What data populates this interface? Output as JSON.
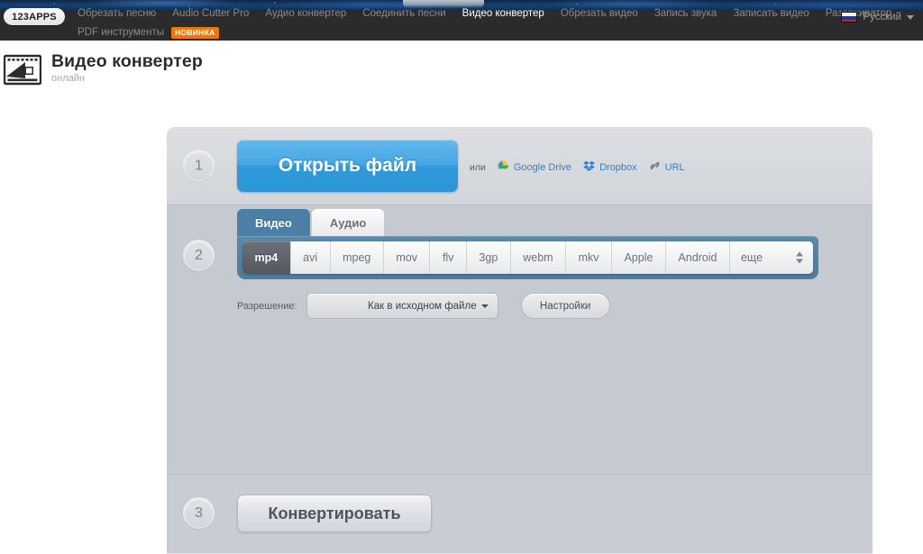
{
  "topnav": {
    "brand": "123APPS",
    "links_row1": [
      {
        "label": "Обрезать песню",
        "active": false
      },
      {
        "label": "Audio Cutter Pro",
        "active": false
      },
      {
        "label": "Аудио конвертер",
        "active": false
      },
      {
        "label": "Соединить песни",
        "active": false
      },
      {
        "label": "Видео конвертер",
        "active": true
      },
      {
        "label": "Обрезать видео",
        "active": false
      },
      {
        "label": "Запись звука",
        "active": false
      },
      {
        "label": "Записать видео",
        "active": false
      },
      {
        "label": "Разархиватор",
        "active": false
      }
    ],
    "links_row2": [
      {
        "label": "PDF инструменты",
        "active": false
      }
    ],
    "badge": "НОВИНКА",
    "badge_color": "#f0740f",
    "language": {
      "label": "Русский",
      "flag": "ru-flag-icon"
    }
  },
  "header": {
    "title": "Видео конвертер",
    "subtitle": "онлайн",
    "logo_icon": "video-converter-logo-icon"
  },
  "steps": {
    "one": {
      "number": "1",
      "open_button": "Открыть файл",
      "or_label": "или",
      "sources": [
        {
          "label": "Google Drive",
          "icon": "google-drive-icon"
        },
        {
          "label": "Dropbox",
          "icon": "dropbox-icon"
        },
        {
          "label": "URL",
          "icon": "link-icon"
        }
      ]
    },
    "two": {
      "number": "2",
      "tabs": [
        {
          "label": "Видео",
          "active": true
        },
        {
          "label": "Аудио",
          "active": false
        }
      ],
      "formats": [
        {
          "label": "mp4",
          "selected": true
        },
        {
          "label": "avi",
          "selected": false
        },
        {
          "label": "mpeg",
          "selected": false
        },
        {
          "label": "mov",
          "selected": false
        },
        {
          "label": "flv",
          "selected": false
        },
        {
          "label": "3gp",
          "selected": false
        },
        {
          "label": "webm",
          "selected": false
        },
        {
          "label": "mkv",
          "selected": false
        },
        {
          "label": "Apple",
          "selected": false
        },
        {
          "label": "Android",
          "selected": false
        }
      ],
      "more_label": "еще",
      "resolution_label": "Разрешение:",
      "resolution_value": "Как в исходном файле",
      "settings_button": "Настройки"
    },
    "three": {
      "number": "3",
      "convert_button": "Конвертировать"
    }
  },
  "colors": {
    "accent_blue": "#2f9ad9",
    "tab_blue": "#4b7fa6",
    "panel_gray": "#c8ccd3",
    "nav_dark": "#2b2b2d",
    "link_blue": "#3b7cc4"
  }
}
